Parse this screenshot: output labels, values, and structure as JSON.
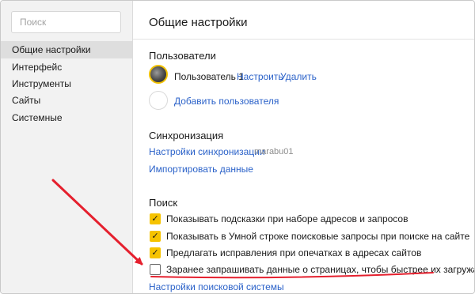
{
  "sidebar": {
    "search_placeholder": "Поиск",
    "items": [
      {
        "label": "Общие настройки",
        "active": true
      },
      {
        "label": "Интерфейс"
      },
      {
        "label": "Инструменты"
      },
      {
        "label": "Сайты"
      },
      {
        "label": "Системные"
      }
    ]
  },
  "main": {
    "title": "Общие настройки",
    "users": {
      "title": "Пользователи",
      "user_name": "Пользователь 1",
      "configure": "Настроить",
      "delete": "Удалить",
      "add_user": "Добавить пользователя"
    },
    "sync": {
      "title": "Синхронизация",
      "settings_link": "Настройки синхронизации",
      "account": "marabu01",
      "import_link": "Импортировать данные"
    },
    "search": {
      "title": "Поиск",
      "options": [
        {
          "label": "Показывать подсказки при наборе адресов и запросов",
          "checked": true
        },
        {
          "label": "Показывать в Умной строке поисковые запросы при поиске на сайте",
          "checked": true
        },
        {
          "label": "Предлагать исправления при опечатках в адресах сайтов",
          "checked": true
        },
        {
          "label": "Заранее запрашивать данные о страницах, чтобы быстрее их загружать",
          "checked": false
        }
      ],
      "engine_link": "Настройки поисковой системы"
    }
  },
  "colors": {
    "accent_yellow": "#f6c300",
    "link_blue": "#2b62c9",
    "annotation_red": "#e5202e"
  }
}
